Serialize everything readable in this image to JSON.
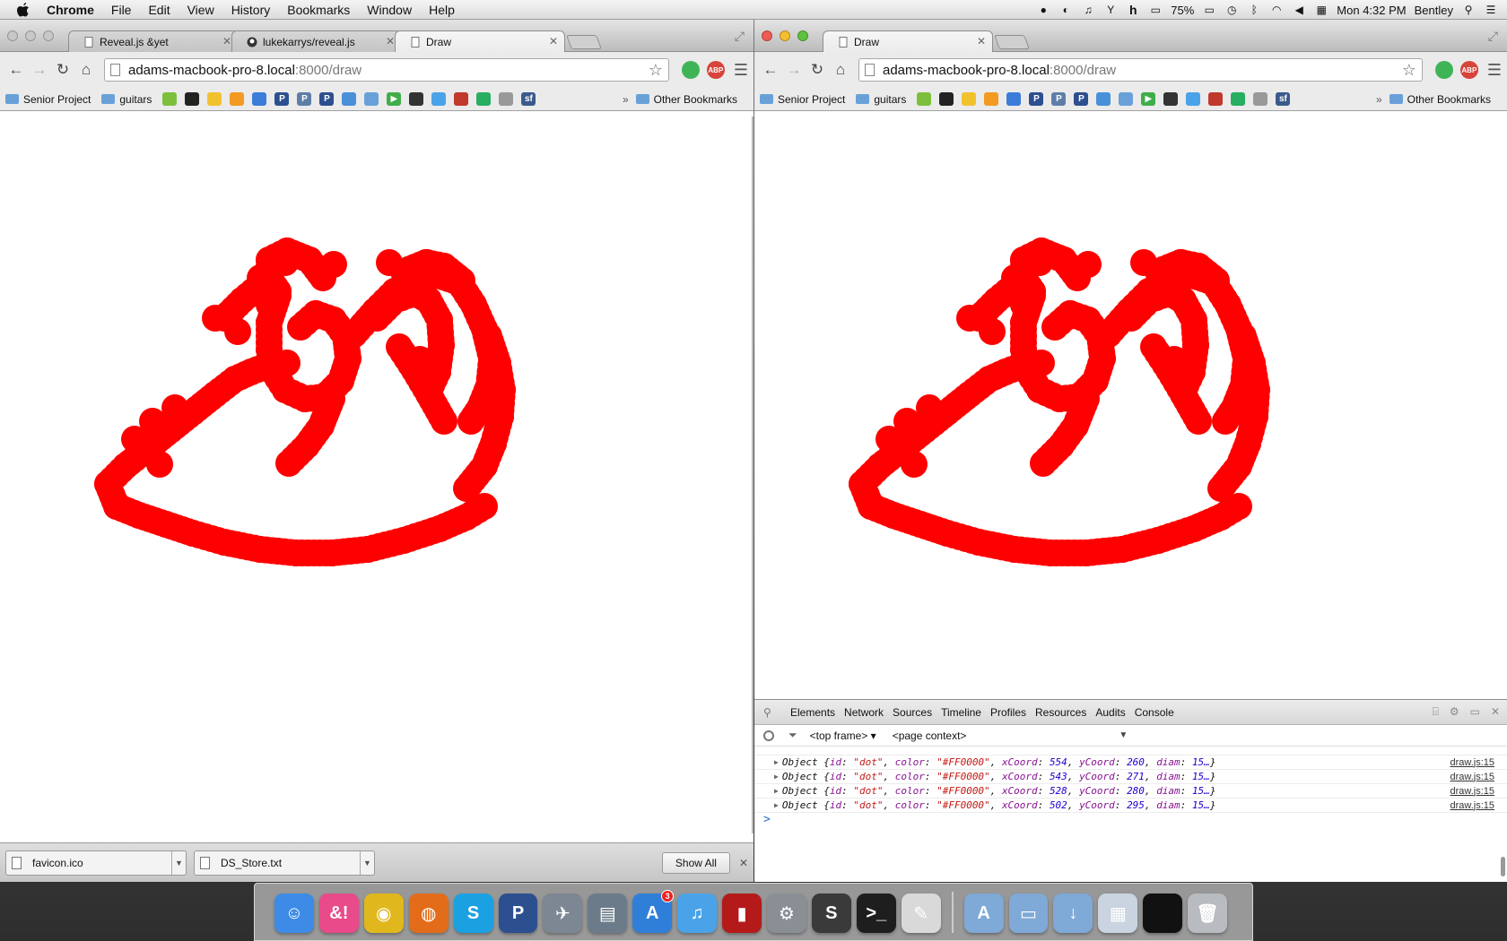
{
  "menubar": {
    "items": [
      "Chrome",
      "File",
      "Edit",
      "View",
      "History",
      "Bookmarks",
      "Window",
      "Help"
    ],
    "battery": "75%",
    "clock": "Mon 4:32 PM",
    "user": "Bentley"
  },
  "left_window": {
    "tabs": [
      {
        "label": "Reveal.js &yet",
        "icon": "page-icon"
      },
      {
        "label": "lukekarrys/reveal.js",
        "icon": "github-icon"
      },
      {
        "label": "Draw",
        "icon": "page-icon"
      }
    ],
    "url_host": "adams-macbook-pro-8.local",
    "url_path": ":8000/draw",
    "downloads": [
      "favicon.ico",
      "DS_Store.txt"
    ],
    "show_all": "Show All"
  },
  "right_window": {
    "tabs": [
      {
        "label": "Draw",
        "icon": "page-icon"
      }
    ],
    "url_host": "adams-macbook-pro-8.local",
    "url_path": ":8000/draw"
  },
  "bookmarks": {
    "folders": [
      "Senior Project",
      "guitars"
    ],
    "more": "»",
    "other": "Other Bookmarks"
  },
  "drawing": {
    "color": "#FF0000",
    "dot_diameter": 15,
    "canvas": "Draw"
  },
  "devtools": {
    "tabs": [
      "Elements",
      "Network",
      "Sources",
      "Timeline",
      "Profiles",
      "Resources",
      "Audits",
      "Console"
    ],
    "selected_tab": "Console",
    "frame_select": "<top frame>",
    "context_select": "<page context>",
    "log_rows": [
      {
        "id": "\"dot\"",
        "color": "\"#FF0000\"",
        "x": "554",
        "y": "260",
        "diam": "15…",
        "src": "draw.js:15"
      },
      {
        "id": "\"dot\"",
        "color": "\"#FF0000\"",
        "x": "543",
        "y": "271",
        "diam": "15…",
        "src": "draw.js:15"
      },
      {
        "id": "\"dot\"",
        "color": "\"#FF0000\"",
        "x": "528",
        "y": "280",
        "diam": "15…",
        "src": "draw.js:15"
      },
      {
        "id": "\"dot\"",
        "color": "\"#FF0000\"",
        "x": "502",
        "y": "295",
        "diam": "15…",
        "src": "draw.js:15"
      }
    ],
    "object_label": "Object",
    "prompt": ">"
  },
  "dock": {
    "icons": [
      {
        "name": "finder",
        "color": "#3d8be6",
        "glyph": "☺"
      },
      {
        "name": "andand",
        "color": "#e84a8a",
        "glyph": "&!"
      },
      {
        "name": "chrome",
        "color": "#e0b81e",
        "glyph": "◉"
      },
      {
        "name": "firefox",
        "color": "#e36c1a",
        "glyph": "◍"
      },
      {
        "name": "skype",
        "color": "#1ba1e2",
        "glyph": "S"
      },
      {
        "name": "pandora",
        "color": "#2c4f8f",
        "glyph": "P"
      },
      {
        "name": "launchpad",
        "color": "#7d8793",
        "glyph": "✈"
      },
      {
        "name": "photo",
        "color": "#6c7b8a",
        "glyph": "▤"
      },
      {
        "name": "app-store",
        "color": "#2f7fd8",
        "glyph": "A",
        "badge": "3"
      },
      {
        "name": "itunes",
        "color": "#4aa3e8",
        "glyph": "♫"
      },
      {
        "name": "photo-booth",
        "color": "#b51a1a",
        "glyph": "▮"
      },
      {
        "name": "system-preferences",
        "color": "#8a8f96",
        "glyph": "⚙"
      },
      {
        "name": "sublime-text",
        "color": "#3a3a3a",
        "glyph": "S"
      },
      {
        "name": "terminal",
        "color": "#1e1e1e",
        "glyph": ">_"
      },
      {
        "name": "textedit",
        "color": "#d9d9d9",
        "glyph": "✎"
      },
      {
        "name": "applications-folder",
        "color": "#7fa9d6",
        "glyph": "A"
      },
      {
        "name": "documents-folder",
        "color": "#7fa9d6",
        "glyph": "▭"
      },
      {
        "name": "downloads-folder",
        "color": "#7fa9d6",
        "glyph": "↓"
      },
      {
        "name": "screenshot",
        "color": "#c9d4e0",
        "glyph": "▦"
      },
      {
        "name": "terminal-window",
        "color": "#111",
        "glyph": ""
      },
      {
        "name": "trash",
        "color": "#b8bcc0",
        "glyph": "🗑"
      }
    ]
  }
}
